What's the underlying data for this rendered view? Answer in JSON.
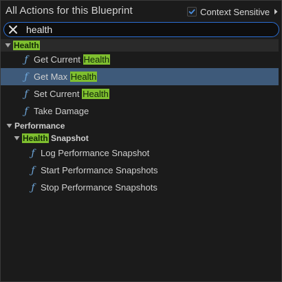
{
  "header": {
    "title": "All Actions for this Blueprint",
    "context_label": "Context Sensitive",
    "context_checked": true
  },
  "search": {
    "value": "health",
    "placeholder": ""
  },
  "tree": {
    "health_category": {
      "label": "Health",
      "items": [
        {
          "prefix": "Get Current ",
          "match": "Health"
        },
        {
          "prefix": "Get Max ",
          "match": "Health"
        },
        {
          "prefix": "Set Current ",
          "match": "Health"
        },
        {
          "label": "Take Damage"
        }
      ]
    },
    "performance_category": {
      "label": "Performance",
      "subcategory": {
        "match": "Health",
        "suffix": " Snapshot",
        "items": [
          {
            "label": "Log Performance Snapshot"
          },
          {
            "label": "Start Performance Snapshots"
          },
          {
            "label": "Stop Performance Snapshots"
          }
        ]
      }
    }
  },
  "colors": {
    "accent": "#2b6fd6",
    "selection": "#3e5a7a",
    "highlight": "#7fbf2f",
    "function_icon": "#6fa8dc"
  },
  "icons": [
    "clear-icon",
    "checkmark-icon",
    "chevron-right-icon",
    "caret-down-icon",
    "function-icon"
  ]
}
